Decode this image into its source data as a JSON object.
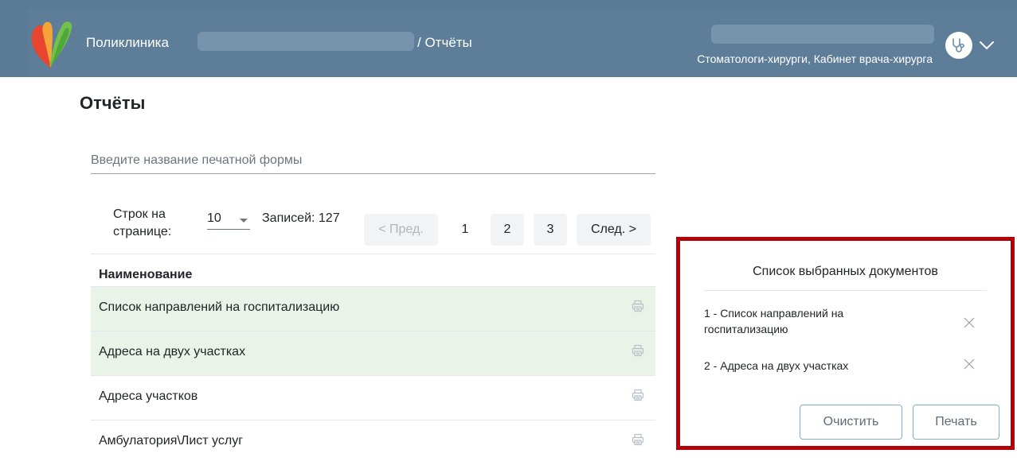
{
  "header": {
    "clinic_label": "Поликлиника",
    "breadcrumb": "/ Отчёты",
    "specialty": "Стоматологи-хирурги, Кабинет врача-хирурга"
  },
  "page": {
    "title": "Отчёты"
  },
  "search": {
    "placeholder": "Введите название печатной формы"
  },
  "pagination": {
    "rows_label": "Строк на странице:",
    "rows_value": "10",
    "records_label": "Записей:",
    "records_count": "127",
    "prev_label": "< Пред.",
    "pages": [
      "1",
      "2",
      "3"
    ],
    "next_label": "След. >"
  },
  "table": {
    "column_header": "Наименование",
    "rows": [
      {
        "name": "Список направлений на госпитализацию",
        "selected": true
      },
      {
        "name": "Адреса на двух участках",
        "selected": true
      },
      {
        "name": "Адреса участков",
        "selected": false
      },
      {
        "name": "Амбулатория\\Лист услуг",
        "selected": false
      }
    ]
  },
  "selected_panel": {
    "title": "Список выбранных документов",
    "items": [
      "1 - Список направлений на госпитализацию",
      "2 - Адреса на двух участках"
    ],
    "clear_label": "Очистить",
    "print_label": "Печать",
    "highlight_color": "#b30008"
  },
  "colors": {
    "header_bg": "#5d7d98",
    "selected_row_bg": "#eaf3e8",
    "button_border": "#7fb2c9"
  }
}
